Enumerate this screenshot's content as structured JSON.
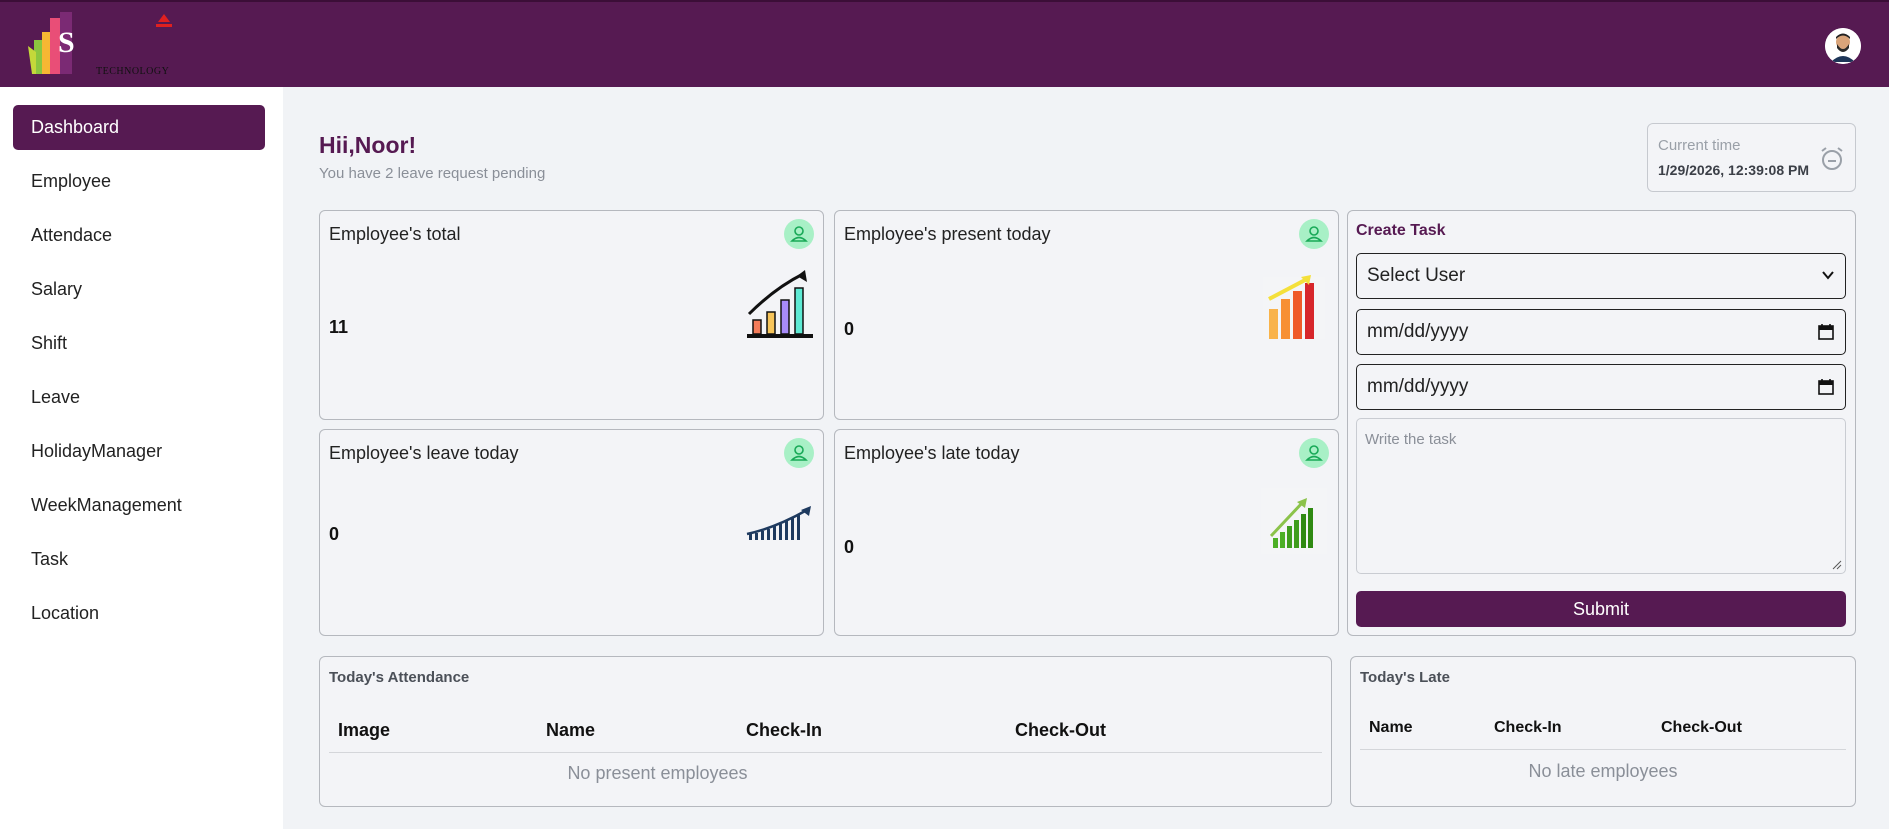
{
  "header": {
    "logo_letter": "S",
    "logo_text": "TECHNOLOGY",
    "avatar_icon": "user-avatar-icon"
  },
  "colors": {
    "brand": "#561a52",
    "badge": "#a8f0c6",
    "background": "#f1f3f6"
  },
  "sidebar": {
    "items": [
      {
        "label": "Dashboard",
        "active": true
      },
      {
        "label": "Employee"
      },
      {
        "label": "Attendace"
      },
      {
        "label": "Salary"
      },
      {
        "label": "Shift"
      },
      {
        "label": "Leave"
      },
      {
        "label": "HolidayManager"
      },
      {
        "label": "WeekManagement"
      },
      {
        "label": "Task"
      },
      {
        "label": "Location"
      }
    ]
  },
  "greeting": {
    "title": "Hii,Noor!",
    "subtitle": "You have 2 leave request pending"
  },
  "current_time": {
    "label": "Current time",
    "value": "1/29/2026, 12:39:08 PM",
    "icon": "alarm-clock-icon"
  },
  "stats": [
    {
      "title": "Employee's total",
      "value": "11",
      "icon": "user-icon",
      "chart_icon": "growth-bar-chart-icon"
    },
    {
      "title": "Employee's present today",
      "value": "0",
      "icon": "user-icon",
      "chart_icon": "rising-bar-chart-icon"
    },
    {
      "title": "Employee's leave today",
      "value": "0",
      "icon": "user-icon",
      "chart_icon": "trend-arrow-chart-icon"
    },
    {
      "title": "Employee's late today",
      "value": "0",
      "icon": "user-icon",
      "chart_icon": "green-bar-chart-icon"
    }
  ],
  "create_task": {
    "title": "Create Task",
    "select_user": "Select User",
    "start_date_placeholder": "mm/dd/yyyy",
    "end_date_placeholder": "mm/dd/yyyy",
    "task_placeholder": "Write the task",
    "submit_label": "Submit"
  },
  "attendance": {
    "title": "Today's Attendance",
    "columns": [
      "Image",
      "Name",
      "Check-In",
      "Check-Out"
    ],
    "empty": "No present employees"
  },
  "late": {
    "title": "Today's Late",
    "columns": [
      "Name",
      "Check-In",
      "Check-Out"
    ],
    "empty": "No late employees"
  }
}
